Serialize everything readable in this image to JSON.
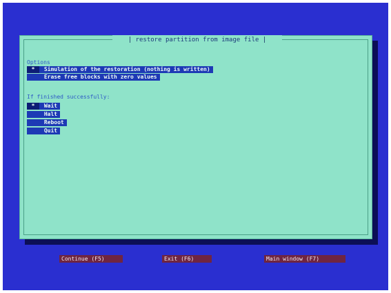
{
  "colors": {
    "screen_background": "#2a2fd0",
    "dialog_background": "#8fe3c9",
    "selected_item_background": "#1d39b5",
    "button_background": "#6f2541",
    "section_title_text": "#2d58c6"
  },
  "dialog": {
    "title": "restore partition from image file"
  },
  "options": {
    "heading": "Options",
    "items": [
      {
        "indicator": "*",
        "label": "Simulation of the restoration (nothing is written)"
      },
      {
        "indicator": " ",
        "label": "Erase free blocks with zero values"
      }
    ]
  },
  "finish": {
    "heading": "If finished successfully:",
    "items": [
      {
        "indicator": "*",
        "label": "Wait"
      },
      {
        "indicator": " ",
        "label": "Halt"
      },
      {
        "indicator": " ",
        "label": "Reboot"
      },
      {
        "indicator": " ",
        "label": "Quit"
      }
    ]
  },
  "buttons": {
    "continue": "Continue (F5)",
    "exit": "Exit (F6)",
    "main_window": "Main window (F7)"
  }
}
